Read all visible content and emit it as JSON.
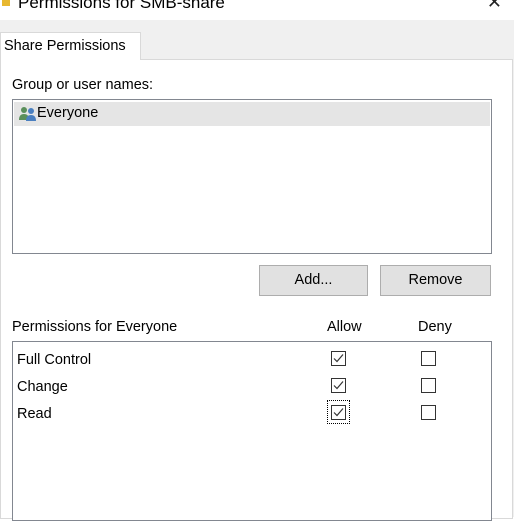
{
  "window": {
    "title": "Permissions for SMB-share",
    "close_glyph": "✕"
  },
  "tabs": [
    {
      "label": "Share Permissions",
      "active": true
    }
  ],
  "group_section": {
    "label": "Group or user names:",
    "users": [
      {
        "name": "Everyone",
        "icon": "users-icon",
        "selected": true
      }
    ]
  },
  "buttons": {
    "add": "Add...",
    "remove": "Remove"
  },
  "permissions": {
    "header": "Permissions for Everyone",
    "allow_header": "Allow",
    "deny_header": "Deny",
    "rows": [
      {
        "name": "Full Control",
        "allow": true,
        "deny": false
      },
      {
        "name": "Change",
        "allow": true,
        "deny": false
      },
      {
        "name": "Read",
        "allow": true,
        "deny": false,
        "focused": true
      }
    ]
  },
  "colors": {
    "checkmark": "#333333",
    "selection": "#e5e5e5",
    "dialog_bg": "#f0f0f0"
  }
}
